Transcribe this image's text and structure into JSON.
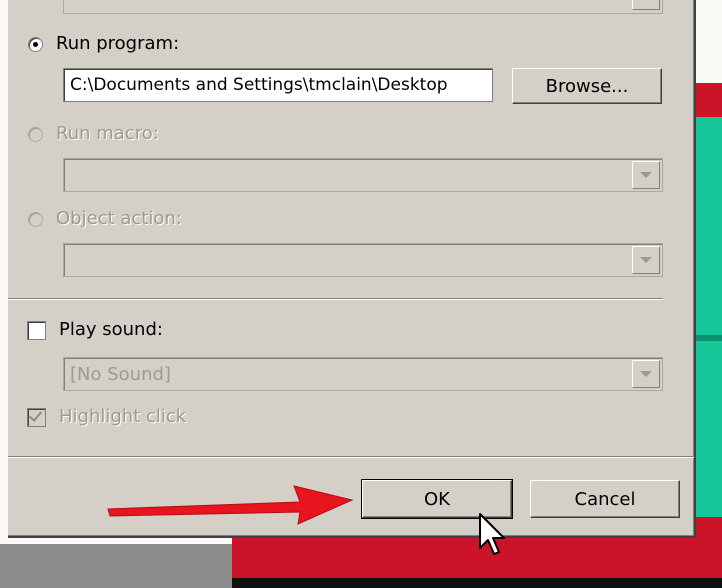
{
  "dialog": {
    "run_program": {
      "label": "Run program:",
      "selected": true
    },
    "program_path": {
      "value": "C:\\Documents and Settings\\tmclain\\Desktop"
    },
    "browse_label": "Browse...",
    "run_macro": {
      "label": "Run macro:",
      "enabled": false
    },
    "macro_select": {
      "value": ""
    },
    "object_action": {
      "label": "Object action:",
      "enabled": false
    },
    "object_action_select": {
      "value": ""
    },
    "play_sound": {
      "label": "Play sound:",
      "checked": false
    },
    "sound_select": {
      "value": "[No Sound]"
    },
    "highlight_click": {
      "label": "Highlight click",
      "checked": true,
      "enabled": false
    },
    "ok_label": "OK",
    "cancel_label": "Cancel"
  },
  "icons": {
    "annotation": "red-arrow-icon",
    "cursor": "mouse-pointer-icon"
  },
  "colors": {
    "annotation_arrow": "#e8141e",
    "dialog_face": "#d4d0c8",
    "background_red": "#cc1428",
    "background_teal": "#17c79a"
  }
}
